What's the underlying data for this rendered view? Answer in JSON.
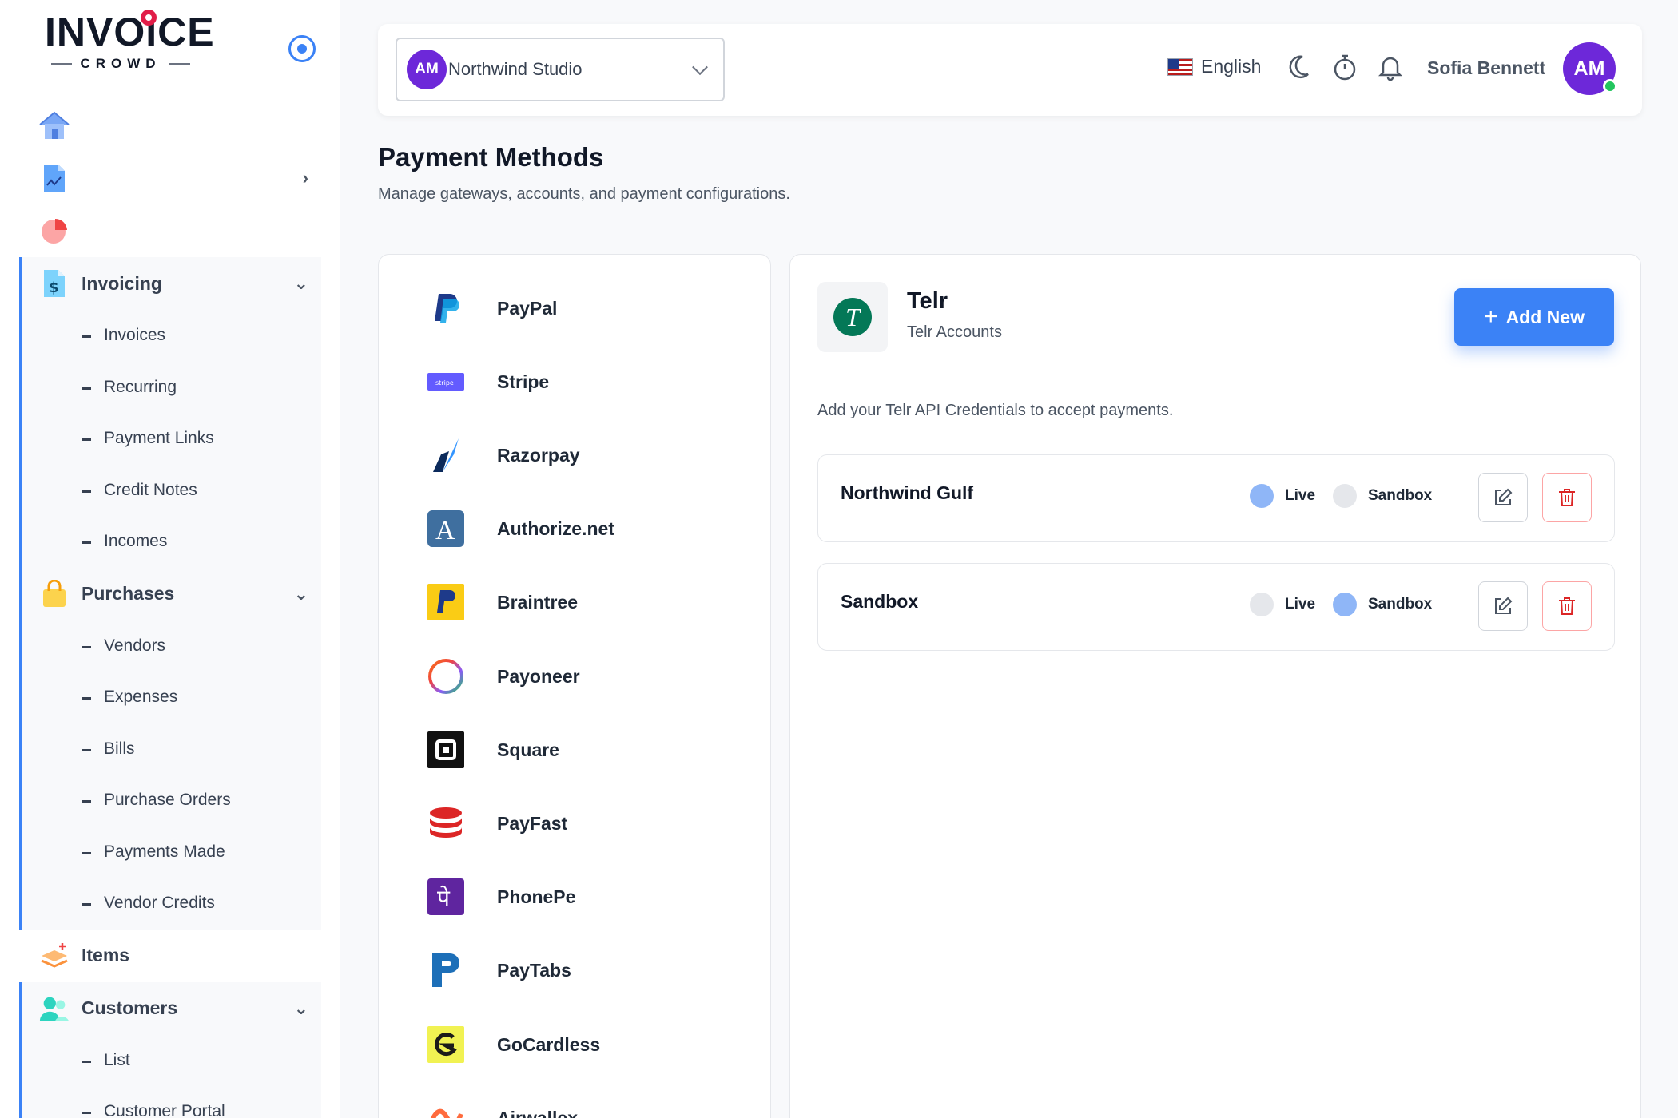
{
  "brand": {
    "name": "INVOICE",
    "sub": "CROWD"
  },
  "sidebar": {
    "items": {
      "label": "Items"
    },
    "invoicing": {
      "label": "Invoicing",
      "children": [
        "Invoices",
        "Recurring",
        "Payment Links",
        "Credit Notes",
        "Incomes"
      ]
    },
    "purchases": {
      "label": "Purchases",
      "children": [
        "Vendors",
        "Expenses",
        "Bills",
        "Purchase Orders",
        "Payments Made",
        "Vendor Credits"
      ]
    },
    "customers": {
      "label": "Customers",
      "children": [
        "List",
        "Customer Portal"
      ]
    }
  },
  "header": {
    "org_initials": "AM",
    "org_name": "Northwind Studio",
    "language": "English",
    "user_name": "Sofia Bennett",
    "user_initials": "AM"
  },
  "page": {
    "title": "Payment Methods",
    "subtitle": "Manage gateways, accounts, and payment configurations."
  },
  "gateways": [
    "PayPal",
    "Stripe",
    "Razorpay",
    "Authorize.net",
    "Braintree",
    "Payoneer",
    "Square",
    "PayFast",
    "PhonePe",
    "PayTabs",
    "GoCardless",
    "Airwallex"
  ],
  "detail": {
    "logo_letter": "T",
    "title": "Telr",
    "subtitle": "Telr Accounts",
    "add_label": "Add New",
    "description": "Add your Telr API Credentials to accept payments.",
    "live_label": "Live",
    "sandbox_label": "Sandbox",
    "accounts": [
      {
        "name": "Northwind Gulf",
        "mode": "live"
      },
      {
        "name": "Sandbox",
        "mode": "sandbox"
      }
    ]
  },
  "colors": {
    "accent": "#3b82f6",
    "avatar": "#6d28d9",
    "telr": "#047857",
    "danger": "#dc2626"
  }
}
